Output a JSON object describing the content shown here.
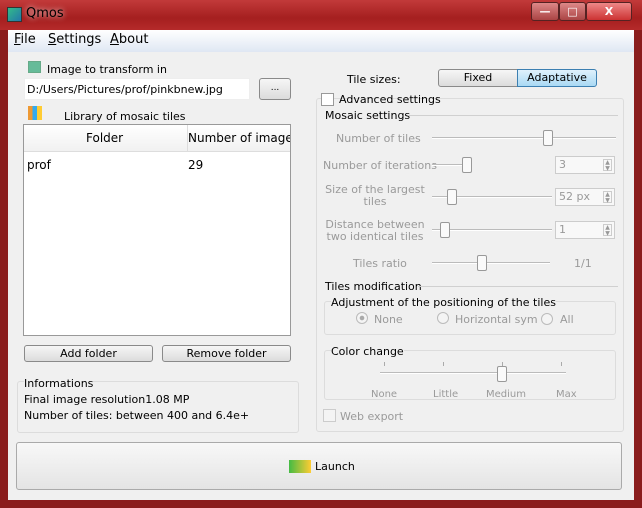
{
  "window": {
    "title": "Qmos",
    "minimize": "—",
    "maximize": "□",
    "close": "X"
  },
  "menu": [
    {
      "label": "File",
      "u": "F",
      "rest": "ile"
    },
    {
      "label": "Settings",
      "u": "S",
      "rest": "ettings"
    },
    {
      "label": "About",
      "u": "A",
      "rest": "bout"
    }
  ],
  "image": {
    "label": "Image to transform in",
    "path": "D:/Users/Pictures/prof/pinkbnew.jpg",
    "browse": "..."
  },
  "library": {
    "label": "Library of mosaic tiles",
    "columns": [
      "Folder",
      "Number of image"
    ],
    "rows": [
      {
        "folder": "prof",
        "count": "29"
      }
    ],
    "add": "Add folder",
    "remove": "Remove folder"
  },
  "info": {
    "title": "Informations",
    "resolution": "Final image resolution1.08 MP",
    "tiles": "Number of tiles:  between 400 and 6.4e+"
  },
  "tile_sizes": {
    "label": "Tile sizes:",
    "fixed": "Fixed",
    "adaptative": "Adaptative",
    "selected": "Adaptative"
  },
  "advanced": {
    "label": "Advanced settings",
    "checked": false
  },
  "mosaic": {
    "title": "Mosaic settings",
    "num_tiles": "Number of tiles",
    "num_tiles_level": 0.67,
    "iterations": "Number of iterations",
    "iterations_value": "3",
    "largest_a": "Size of the largest",
    "largest_b": "tiles",
    "largest_value": "52 px",
    "distance_a": "Distance between",
    "distance_b": "two identical tiles",
    "distance_value": "1",
    "ratio": "Tiles ratio",
    "ratio_value": "1/1"
  },
  "modification": {
    "title": "Tiles modification",
    "adjust_title": "Adjustment of the positioning of the tiles",
    "opts": [
      "None",
      "Horizontal sym",
      "All"
    ],
    "selected": "None",
    "color_title": "Color change",
    "color_levels": [
      "None",
      "Little",
      "Medium",
      "Max"
    ],
    "color_selected": "Medium"
  },
  "web_export": "Web export",
  "launch": "Launch"
}
